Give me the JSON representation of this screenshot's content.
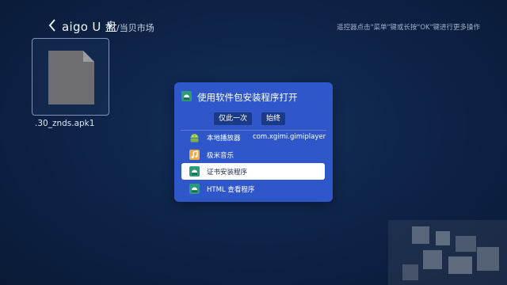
{
  "header": {
    "back_icon": "chevron-left-icon",
    "title": "aigo U 盘",
    "breadcrumb": "/当贝市场",
    "hint": "遥控器点击\"菜单\"键或长按\"OK\"键进行更多操作"
  },
  "file": {
    "icon": "document-icon",
    "name": ".30_znds.apk1"
  },
  "dialog": {
    "icon": "android-app-icon",
    "title": "使用软件包安装程序打开",
    "buttons": {
      "once": "仅此一次",
      "always": "始终"
    },
    "apps": [
      {
        "label": "本地播放器",
        "extra": "com.xgimi.gimiplayer",
        "icon": "android-green-icon"
      },
      {
        "label": "极米音乐",
        "icon": "music-app-icon"
      },
      {
        "label": "证书安装程序",
        "icon": "android-installer-icon",
        "selected": true
      },
      {
        "label": "HTML 查看程序",
        "icon": "android-installer-icon"
      }
    ]
  },
  "colors": {
    "background": "#0e2449",
    "dialog": "#2f57c9",
    "selected_row": "#ffffff"
  }
}
